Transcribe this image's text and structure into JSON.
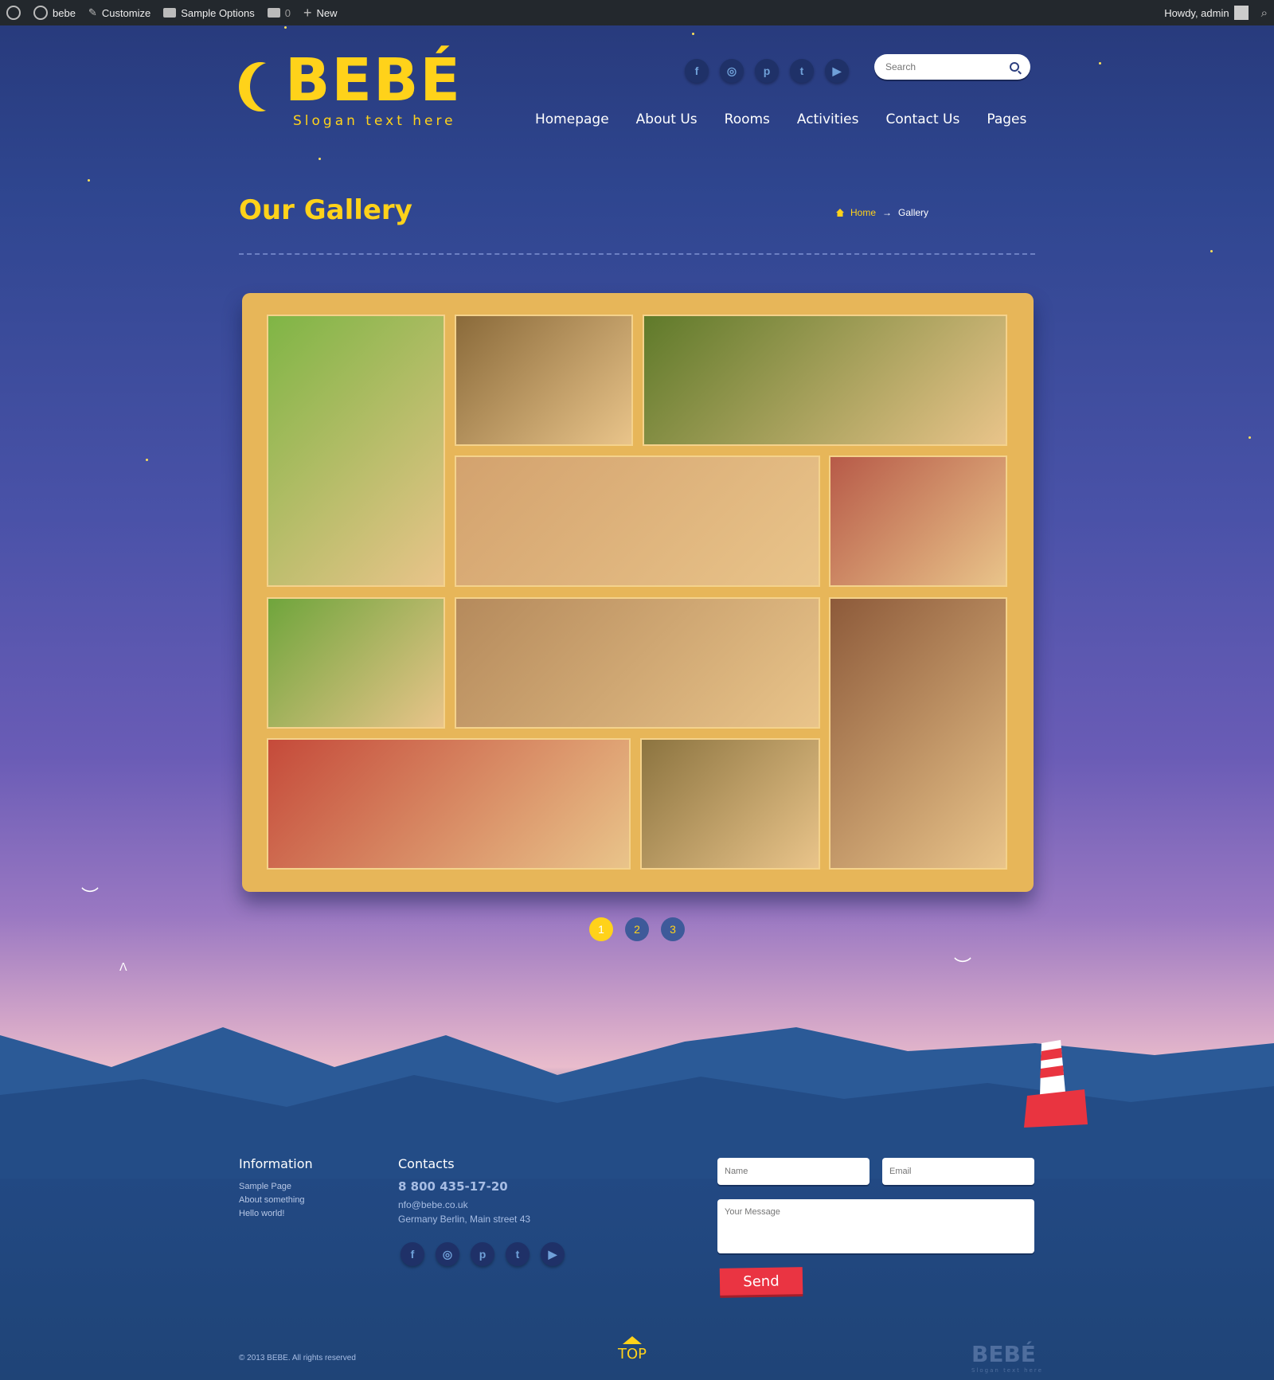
{
  "admin_bar": {
    "site_name": "bebe",
    "customize": "Customize",
    "sample_options": "Sample Options",
    "comments_count": "0",
    "new": "New",
    "howdy": "Howdy, admin"
  },
  "header": {
    "logo_text": "BEBÉ",
    "slogan": "Slogan text here",
    "search_placeholder": "Search",
    "social": [
      "f",
      "◎",
      "p",
      "t",
      "▶"
    ],
    "nav": [
      "Homepage",
      "About Us",
      "Rooms",
      "Activities",
      "Contact Us",
      "Pages"
    ]
  },
  "page": {
    "title": "Our Gallery",
    "breadcrumb_home": "Home",
    "breadcrumb_sep": "→",
    "breadcrumb_current": "Gallery"
  },
  "gallery": {
    "photos": [
      {
        "name": "girl-blowing-dandelion",
        "color": "#7fb545"
      },
      {
        "name": "upside-down-kid",
        "color": "#8a6a3a"
      },
      {
        "name": "boy-with-apples",
        "color": "#5f7a2a"
      },
      {
        "name": "three-smiling-kids",
        "color": "#d3a26e"
      },
      {
        "name": "boy-drawing",
        "color": "#b75a48"
      },
      {
        "name": "smiling-boy",
        "color": "#6fa53c"
      },
      {
        "name": "group-of-kids",
        "color": "#b58a5c"
      },
      {
        "name": "toddler-in-snow-clothes",
        "color": "#8d5a3a"
      },
      {
        "name": "toddler-on-carousel",
        "color": "#c54a3a"
      },
      {
        "name": "girl-with-pigtails",
        "color": "#8c7440"
      }
    ]
  },
  "pagination": {
    "pages": [
      "1",
      "2",
      "3"
    ],
    "current": "1"
  },
  "footer": {
    "info_heading": "Information",
    "info_links": [
      "Sample Page",
      "About something",
      "Hello world!"
    ],
    "contacts_heading": "Contacts",
    "phone": "8 800 435-17-20",
    "email": "nfo@bebe.co.uk",
    "address": "Germany Berlin, Main street 43",
    "social": [
      "f",
      "◎",
      "p",
      "t",
      "▶"
    ],
    "form": {
      "name_placeholder": "Name",
      "email_placeholder": "Email",
      "message_placeholder": "Your Message",
      "send": "Send"
    },
    "copyright": "© 2013 BEBE. All rights reserved",
    "top": "TOP",
    "logo": "BEBÉ",
    "logo_slogan": "Slogan text here"
  },
  "colors": {
    "accent": "#ffd21a",
    "frame": "#e7b659",
    "send": "#ea3442",
    "sky_top": "#27397a"
  }
}
